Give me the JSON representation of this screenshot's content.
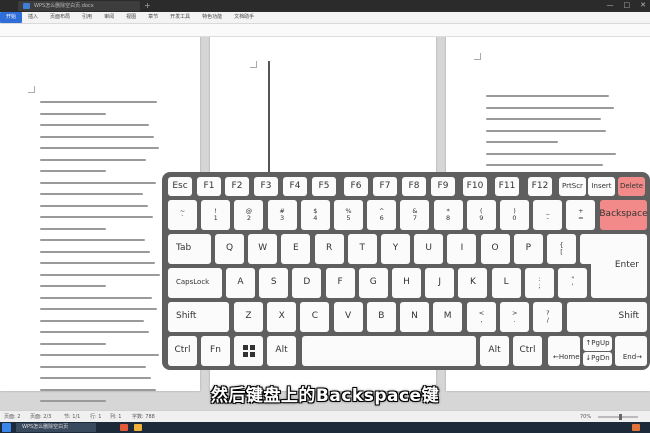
{
  "window": {
    "doc_tab_title": "WPS怎么删除空白页.docx",
    "new_tab": "+",
    "minimize": "—",
    "maximize": "□",
    "close": "✕"
  },
  "menu": [
    {
      "label": "开始",
      "active": true
    },
    {
      "label": "插入"
    },
    {
      "label": "页面布局"
    },
    {
      "label": "引用"
    },
    {
      "label": "审阅"
    },
    {
      "label": "视图"
    },
    {
      "label": "章节"
    },
    {
      "label": "开发工具"
    },
    {
      "label": "特色功能"
    },
    {
      "label": "文档助手"
    }
  ],
  "keyboard": {
    "row_fn": [
      "Esc",
      "F1",
      "F2",
      "F3",
      "F4",
      "F5",
      "F6",
      "F7",
      "F8",
      "F9",
      "F10",
      "F11",
      "F12",
      "PrtScr",
      "Insert",
      "Delete"
    ],
    "row_num": [
      {
        "top": "~",
        "bottom": "`"
      },
      {
        "top": "!",
        "bottom": "1"
      },
      {
        "top": "@",
        "bottom": "2"
      },
      {
        "top": "#",
        "bottom": "3"
      },
      {
        "top": "$",
        "bottom": "4"
      },
      {
        "top": "%",
        "bottom": "5"
      },
      {
        "top": "^",
        "bottom": "6"
      },
      {
        "top": "&",
        "bottom": "7"
      },
      {
        "top": "*",
        "bottom": "8"
      },
      {
        "top": "(",
        "bottom": "9"
      },
      {
        "top": ")",
        "bottom": "0"
      },
      {
        "top": "_",
        "bottom": "-"
      },
      {
        "top": "+",
        "bottom": "="
      }
    ],
    "backspace": "Backspace",
    "tab": "Tab",
    "row_q": [
      "Q",
      "W",
      "E",
      "R",
      "T",
      "Y",
      "U",
      "I",
      "O",
      "P"
    ],
    "row_q_sym": [
      {
        "top": "{",
        "bottom": "["
      },
      {
        "top": "}",
        "bottom": "]"
      },
      {
        "top": "|",
        "bottom": "\\"
      }
    ],
    "capslock": "CapsLock",
    "row_a": [
      "A",
      "S",
      "D",
      "F",
      "G",
      "H",
      "J",
      "K",
      "L"
    ],
    "row_a_sym": [
      {
        "top": ":",
        "bottom": ";"
      },
      {
        "top": "\"",
        "bottom": "'"
      }
    ],
    "enter": "Enter",
    "shift_left": "Shift",
    "row_z": [
      "Z",
      "X",
      "C",
      "V",
      "B",
      "N",
      "M"
    ],
    "row_z_sym": [
      {
        "top": "<",
        "bottom": ","
      },
      {
        "top": ">",
        "bottom": "."
      },
      {
        "top": "?",
        "bottom": "/"
      }
    ],
    "shift_right": "Shift",
    "ctrl_left": "Ctrl",
    "fn": "Fn",
    "alt_left": "Alt",
    "alt_right": "Alt",
    "ctrl_right": "Ctrl",
    "home": "←Home",
    "pgup": "↑PgUp",
    "pgdn": "↓PgDn",
    "end": "End→",
    "highlight_color": "#f28a8a"
  },
  "subtitle": "然后键盘上的Backspace键",
  "status": {
    "page": "页面: 2",
    "pages": "页面: 2/3",
    "section": "节: 1/1",
    "row": "行: 1",
    "col": "列: 1",
    "words": "字数: 788",
    "zoom": "70%",
    "zoom_fraction": 0.55
  },
  "taskbar": {
    "doc_item": "WPS怎么删除空白页"
  }
}
